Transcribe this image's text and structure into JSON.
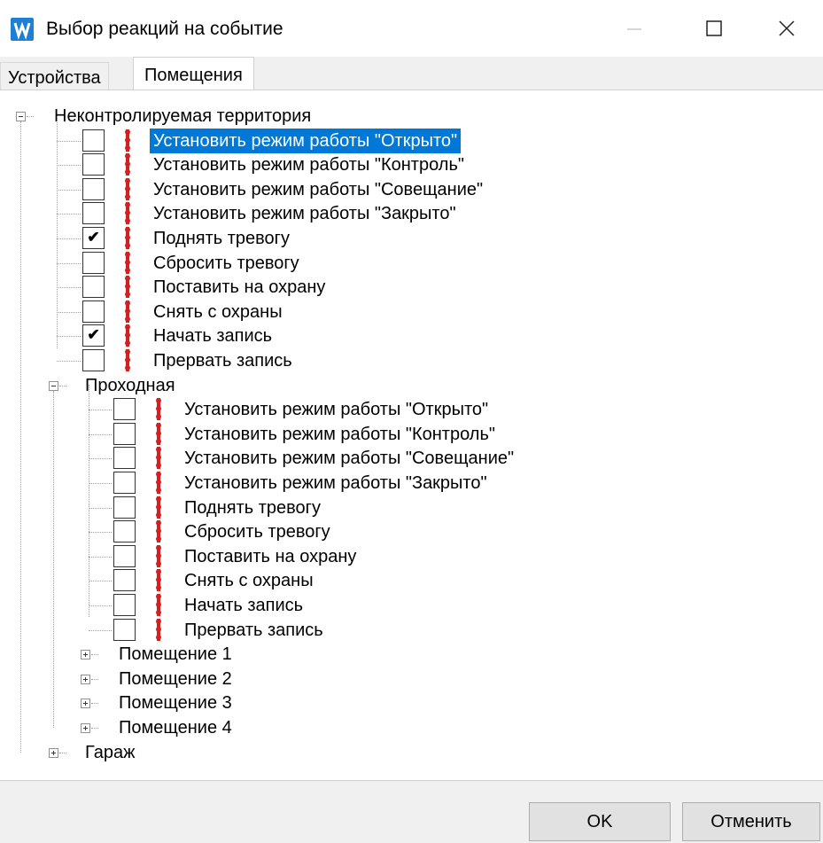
{
  "window": {
    "title": "Выбор реакций на событие"
  },
  "tabs": [
    {
      "label": "Устройства"
    },
    {
      "label": "Помещения"
    }
  ],
  "tree": {
    "root": {
      "label": "Неконтролируемая территория"
    },
    "root_actions": [
      {
        "label": "Установить режим работы \"Открыто\"",
        "checked": false,
        "selected": true
      },
      {
        "label": "Установить режим работы \"Контроль\"",
        "checked": false
      },
      {
        "label": "Установить режим работы \"Совещание\"",
        "checked": false
      },
      {
        "label": "Установить режим работы \"Закрыто\"",
        "checked": false
      },
      {
        "label": "Поднять тревогу",
        "checked": true
      },
      {
        "label": "Сбросить тревогу",
        "checked": false
      },
      {
        "label": "Поставить на охрану",
        "checked": false
      },
      {
        "label": "Снять с охраны",
        "checked": false
      },
      {
        "label": "Начать запись",
        "checked": true
      },
      {
        "label": "Прервать запись",
        "checked": false
      }
    ],
    "child": {
      "label": "Проходная"
    },
    "child_actions": [
      {
        "label": "Установить режим работы \"Открыто\"",
        "checked": false
      },
      {
        "label": "Установить режим работы \"Контроль\"",
        "checked": false
      },
      {
        "label": "Установить режим работы \"Совещание\"",
        "checked": false
      },
      {
        "label": "Установить режим работы \"Закрыто\"",
        "checked": false
      },
      {
        "label": "Поднять тревогу",
        "checked": false
      },
      {
        "label": "Сбросить тревогу",
        "checked": false
      },
      {
        "label": "Поставить на охрану",
        "checked": false
      },
      {
        "label": "Снять с охраны",
        "checked": false
      },
      {
        "label": "Начать запись",
        "checked": false
      },
      {
        "label": "Прервать запись",
        "checked": false
      }
    ],
    "rooms": [
      {
        "label": "Помещение 1"
      },
      {
        "label": "Помещение 2"
      },
      {
        "label": "Помещение 3"
      },
      {
        "label": "Помещение 4"
      }
    ],
    "garage": {
      "label": "Гараж"
    }
  },
  "buttons": {
    "ok": "OK",
    "cancel": "Отменить"
  },
  "colors": {
    "selection": "#0078d7",
    "pin_red": "#d42020",
    "app_icon": "#1e7fd6"
  },
  "icons": {
    "action": "red-pin-icon",
    "check": "✔"
  }
}
